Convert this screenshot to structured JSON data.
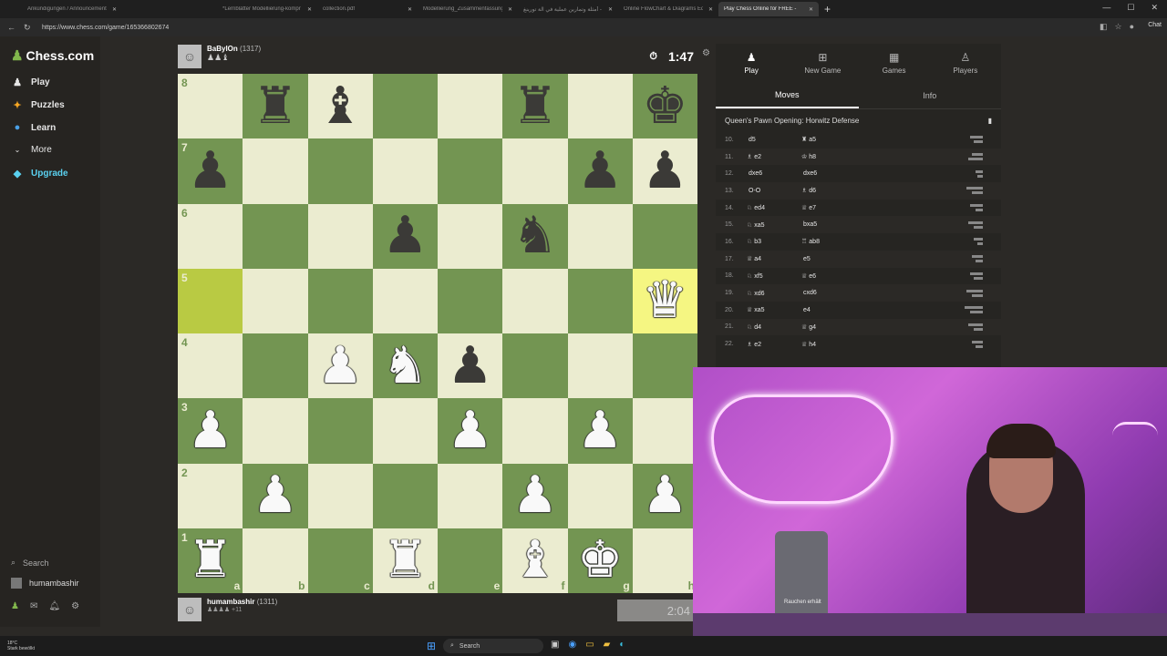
{
  "browser": {
    "tabs": [
      {
        "label": "Ankündigungen / Announcement",
        "active": false
      },
      {
        "label": "",
        "active": false
      },
      {
        "label": "",
        "active": false
      },
      {
        "label": "",
        "active": false
      },
      {
        "label": "",
        "active": false
      },
      {
        "label": "*Lernblätter Modellierung-kompr",
        "active": false
      },
      {
        "label": "collection.pdf",
        "active": false
      },
      {
        "label": "Modellierung_Zusammenfassung",
        "active": false
      },
      {
        "label": "أمثلة وتمارين عملية في آلة تورينغ -",
        "active": false
      },
      {
        "label": "Online FlowChart & Diagrams Edit",
        "active": false
      },
      {
        "label": "Play Chess Online for FREE -",
        "active": true
      }
    ],
    "url": "https://www.chess.com/game/165366802674",
    "chat_label": "Chat"
  },
  "sidebar": {
    "logo": "Chess.com",
    "items": [
      {
        "label": "Play",
        "icon": "pawn-icon"
      },
      {
        "label": "Puzzles",
        "icon": "puzzle-icon"
      },
      {
        "label": "Learn",
        "icon": "learn-icon"
      },
      {
        "label": "More",
        "icon": "chevron-down-icon"
      },
      {
        "label": "Upgrade",
        "icon": "diamond-icon"
      }
    ],
    "search_label": "Search",
    "username": "humambashir"
  },
  "top_player": {
    "name": "BaBylOn",
    "rating": "(1317)",
    "captured": "♟♟♝",
    "clock": "1:47"
  },
  "bottom_player": {
    "name": "humambashir",
    "rating": "(1311)",
    "captured": "♟♟♟♟ +11",
    "clock": "2:04"
  },
  "board": {
    "orientation": "white",
    "ranks": [
      "8",
      "7",
      "6",
      "5",
      "4",
      "3",
      "2",
      "1"
    ],
    "files": [
      "a",
      "b",
      "c",
      "d",
      "e",
      "f",
      "g",
      "h"
    ],
    "highlighted": [
      "a5",
      "h5"
    ],
    "position": {
      "b8": "r",
      "c8": "b",
      "f8": "r",
      "h8": "k",
      "a7": "p",
      "g7": "p",
      "h7": "p",
      "d6": "p",
      "f6": "n",
      "h5": "Q",
      "c4": "P",
      "d4": "N",
      "e4": "p",
      "a3": "P",
      "e3": "P",
      "g3": "P",
      "b2": "P",
      "f2": "P",
      "h2": "P",
      "a1": "R",
      "d1": "R",
      "f1": "B",
      "g1": "K"
    }
  },
  "panel": {
    "tabs": [
      {
        "label": "Play",
        "icon": "pawn-icon",
        "active": true
      },
      {
        "label": "New Game",
        "icon": "plus-icon",
        "active": false
      },
      {
        "label": "Games",
        "icon": "board-icon",
        "active": false
      },
      {
        "label": "Players",
        "icon": "players-icon",
        "active": false
      }
    ],
    "subtabs": [
      {
        "label": "Moves",
        "active": true
      },
      {
        "label": "Info",
        "active": false
      }
    ],
    "opening": "Queen's Pawn Opening: Horwitz Defense",
    "moves": [
      {
        "num": "10.",
        "white": "d5",
        "wp": "",
        "black": "a5",
        "bp": "♜"
      },
      {
        "num": "11.",
        "white": "e2",
        "wp": "♗",
        "black": "h8",
        "bp": "♔"
      },
      {
        "num": "12.",
        "white": "dxe6",
        "wp": "",
        "black": "dxe6",
        "bp": ""
      },
      {
        "num": "13.",
        "white": "O-O",
        "wp": "",
        "black": "d6",
        "bp": "♗"
      },
      {
        "num": "14.",
        "white": "ed4",
        "wp": "♘",
        "black": "e7",
        "bp": "♕"
      },
      {
        "num": "15.",
        "white": "xa5",
        "wp": "♘",
        "black": "bxa5",
        "bp": ""
      },
      {
        "num": "16.",
        "white": "b3",
        "wp": "♘",
        "black": "ab8",
        "bp": "♖"
      },
      {
        "num": "17.",
        "white": "a4",
        "wp": "♕",
        "black": "e5",
        "bp": ""
      },
      {
        "num": "18.",
        "white": "xf5",
        "wp": "♘",
        "black": "e6",
        "bp": "♕"
      },
      {
        "num": "19.",
        "white": "xd6",
        "wp": "♘",
        "black": "cxd6",
        "bp": ""
      },
      {
        "num": "20.",
        "white": "xa5",
        "wp": "♕",
        "black": "e4",
        "bp": ""
      },
      {
        "num": "21.",
        "white": "d4",
        "wp": "♘",
        "black": "g4",
        "bp": "♕"
      },
      {
        "num": "22.",
        "white": "e2",
        "wp": "♗",
        "black": "h4",
        "bp": "♕"
      }
    ]
  },
  "webcam": {
    "can_label": "Rauchen erhält"
  },
  "taskbar": {
    "weather_temp": "18°C",
    "weather_desc": "Stark bewölkt",
    "search_label": "Search"
  }
}
